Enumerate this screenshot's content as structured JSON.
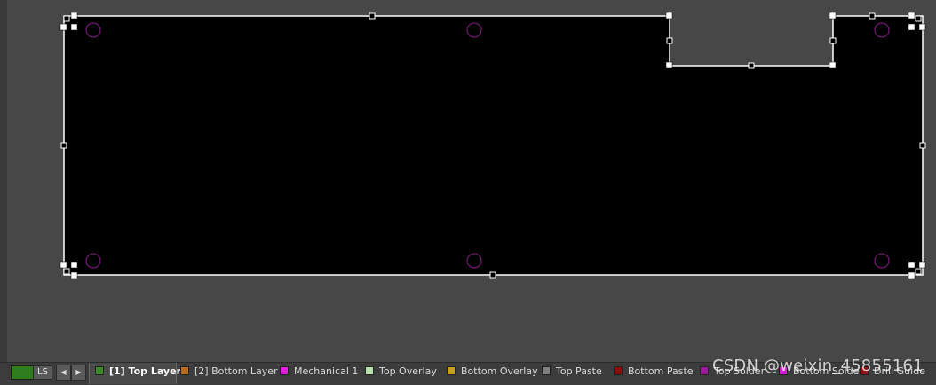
{
  "layer_bar": {
    "ls_label": "LS",
    "prev_glyph": "◀",
    "next_glyph": "▶",
    "tabs": [
      {
        "label": "[1] Top Layer",
        "color": "#3b8a2a",
        "active": true
      },
      {
        "label": "[2] Bottom Layer",
        "color": "#b86a1e",
        "active": false
      },
      {
        "label": "Mechanical 1",
        "color": "#e020e0",
        "active": false
      },
      {
        "label": "Top Overlay",
        "color": "#b8e0a8",
        "active": false
      },
      {
        "label": "Bottom Overlay",
        "color": "#c8a020",
        "active": false
      },
      {
        "label": "Top Paste",
        "color": "#808080",
        "active": false
      },
      {
        "label": "Bottom Paste",
        "color": "#8a1010",
        "active": false
      },
      {
        "label": "Top Solder",
        "color": "#9a1a9a",
        "active": false
      },
      {
        "label": "Bottom Solder",
        "color": "#d020d0",
        "active": false
      },
      {
        "label": "Drill Guide",
        "color": "#8a1010",
        "active": false
      }
    ]
  },
  "watermark": "CSDN @weixin_45855161",
  "colors": {
    "board_fill": "#000000",
    "board_outline": "#ffffff",
    "mounting_hole": "#8a1a8a",
    "background": "#474747"
  }
}
